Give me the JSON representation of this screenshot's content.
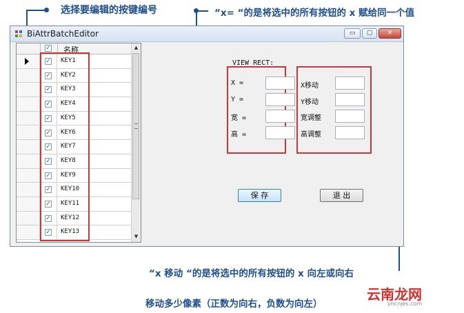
{
  "annotations": {
    "top_left": "选择要编辑的按键编号",
    "top_right": "“x= “的是将选中的所有按钮的 x 赋给同一个值",
    "bottom_line1": "“x 移动 “的是将选中的所有按钮的 x 向左或向右",
    "bottom_line2": "移动多少像素（正数为向右，负数为向左）"
  },
  "window": {
    "title": "BiAttrBatchEditor",
    "controls": {
      "minimize": "▭",
      "maximize": "▢",
      "close": "✕"
    }
  },
  "grid": {
    "header_name": "名称",
    "header_checked": true,
    "current_row": 0,
    "rows": [
      {
        "name": "KEY1",
        "checked": true
      },
      {
        "name": "KEY2",
        "checked": true
      },
      {
        "name": "KEY3",
        "checked": true
      },
      {
        "name": "KEY4",
        "checked": true
      },
      {
        "name": "KEY5",
        "checked": true
      },
      {
        "name": "KEY6",
        "checked": true
      },
      {
        "name": "KEY7",
        "checked": true
      },
      {
        "name": "KEY8",
        "checked": true
      },
      {
        "name": "KEY9",
        "checked": true
      },
      {
        "name": "KEY10",
        "checked": true
      },
      {
        "name": "KEY11",
        "checked": true
      },
      {
        "name": "KEY12",
        "checked": true
      },
      {
        "name": "KEY13",
        "checked": true
      }
    ]
  },
  "view_rect": {
    "title": "VIEW_RECT:",
    "set_fields": [
      {
        "label": "X =",
        "value": ""
      },
      {
        "label": "Y =",
        "value": ""
      },
      {
        "label": "宽 =",
        "value": ""
      },
      {
        "label": "高 =",
        "value": ""
      }
    ],
    "move_fields": [
      {
        "label": "X移动",
        "value": ""
      },
      {
        "label": "Y移动",
        "value": ""
      },
      {
        "label": "宽调整",
        "value": ""
      },
      {
        "label": "高调整",
        "value": ""
      }
    ]
  },
  "buttons": {
    "save": "保 存",
    "exit": "退 出"
  },
  "watermark": {
    "text": "云南龙网",
    "sub": "yncnjes.com"
  },
  "colors": {
    "annotation": "#1f4e8c",
    "highlight": "#c0393b"
  }
}
